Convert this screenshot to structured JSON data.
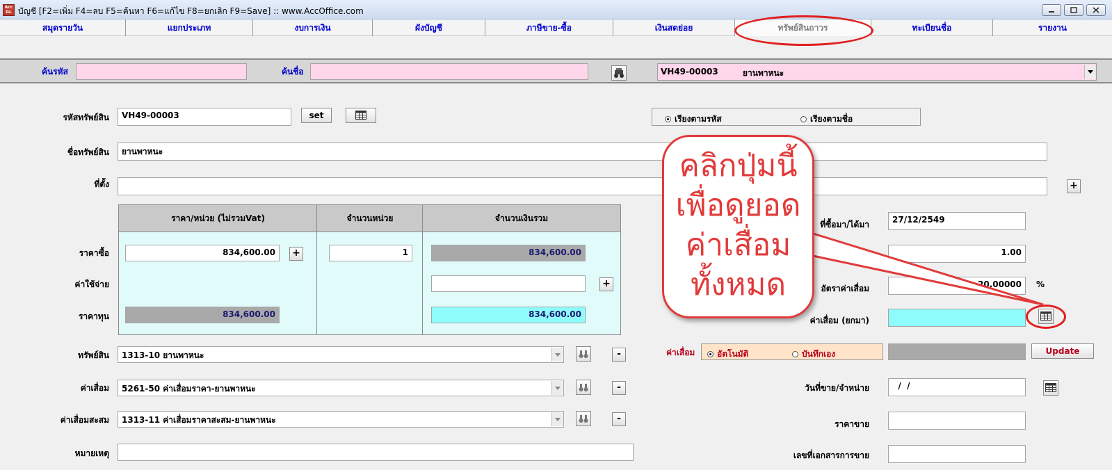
{
  "window": {
    "icon_text": "Acc GL",
    "title": "บัญชี [F2=เพิ่ม F4=ลบ F5=ค้นหา F6=แก้ไข F8=ยกเลิก F9=Save] :: www.AccOffice.com"
  },
  "tabs": [
    {
      "label": "สมุดรายวัน"
    },
    {
      "label": "แยกประเภท"
    },
    {
      "label": "งบการเงิน"
    },
    {
      "label": "ผังบัญชี"
    },
    {
      "label": "ภาษีขาย-ซื้อ"
    },
    {
      "label": "เงินสดย่อย"
    },
    {
      "label": "ทรัพย์สินถาวร",
      "active": true
    },
    {
      "label": "ทะเบียนชื่อ"
    },
    {
      "label": "รายงาน"
    }
  ],
  "search": {
    "code_label": "ค้นรหัส",
    "code_value": "",
    "name_label": "ค้นชื่อ",
    "name_value": "",
    "selected_code": "VH49-00003",
    "selected_name": "ยานพาหนะ"
  },
  "asset": {
    "code_label": "รหัสทรัพย์สิน",
    "code": "VH49-00003",
    "set_button": "set",
    "sort_by_code": "เรียงตามรหัส",
    "sort_by_name": "เรียงตามชื่อ",
    "name_label": "ชื่อทรัพย์สิน",
    "name": "ยานพาหนะ",
    "location_label": "ที่ตั้ง",
    "location": ""
  },
  "price_table": {
    "headers": [
      "ราคา/หน่วย (ไม่รวมVat)",
      "จำนวนหน่วย",
      "จำนวนเงินรวม"
    ],
    "purchase_label": "ราคาซื้อ",
    "unit_price": "834,600.00",
    "units": "1",
    "purchase_total": "834,600.00",
    "expense_label": "ค่าใช้จ่าย",
    "expense_total": "",
    "cost_label": "ราคาทุน",
    "cost_unit": "834,600.00",
    "cost_total": "834,600.00"
  },
  "right_panel": {
    "acquired_label": "ที่ซื้อมา/ได้มา",
    "acquired_date": "27/12/2549",
    "life_value": "1.00",
    "rate_label": "อัตราค่าเสื่อม",
    "rate_value": "20.00000",
    "rate_unit": "%",
    "carried_label": "ค่าเสื่อม (ยกมา)",
    "carried_value": "",
    "method_label": "ค่าเสื่อม",
    "auto_label": "อัตโนมัติ",
    "manual_label": "บันทึกเอง",
    "update_button": "Update",
    "sale_date_label": "วันที่ขาย/จำหน่าย",
    "sale_date": "  /  /",
    "sale_price_label": "ราคาขาย",
    "sale_price": "",
    "sale_doc_label": "เลขที่เอกสารการขาย",
    "sale_doc": ""
  },
  "accounts": {
    "asset_label": "ทรัพย์สิน",
    "asset_value": "1313-10  ยานพาหนะ",
    "dep_label": "ค่าเสื่อม",
    "dep_value": "5261-50  ค่าเสื่อมราคา-ยานพาหนะ",
    "accum_label": "ค่าเสื่อมสะสม",
    "accum_value": "1313-11  ค่าเสื่อมราคาสะสม-ยานพาหนะ",
    "note_label": "หมายเหตุ",
    "note_value": ""
  },
  "callout": {
    "line1": "คลิกปุ่มนี้",
    "line2": "เพื่อดูยอด",
    "line3": "ค่าเสื่อม",
    "line4": "ทั้งหมด"
  },
  "colors": {
    "highlight_red": "#e02020",
    "tab_blue": "#0000d0",
    "pink_field": "#ffd6ea",
    "cyan_field": "#8ffcfc"
  }
}
